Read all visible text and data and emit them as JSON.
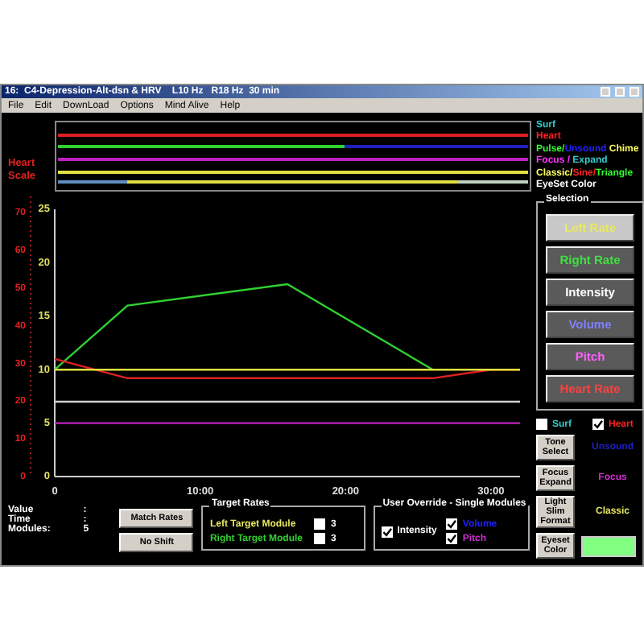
{
  "window": {
    "title": "16:  C4-Depression-Alt-dsn & HRV    L10 Hz   R18 Hz  30 min"
  },
  "menu": [
    "File",
    "Edit",
    "DownLoad",
    "Options",
    "Mind Alive",
    "Help"
  ],
  "legend": [
    {
      "parts": [
        {
          "text": "Surf",
          "color": "#33cccc"
        }
      ]
    },
    {
      "parts": [
        {
          "text": "Heart",
          "color": "#ff2020"
        }
      ]
    },
    {
      "parts": [
        {
          "text": "Pulse/",
          "color": "#30ff30"
        },
        {
          "text": "Unsound",
          "color": "#2020ff"
        },
        {
          "text": " Chime",
          "color": "#ffff60"
        }
      ]
    },
    {
      "parts": [
        {
          "text": "Focus / ",
          "color": "#ff30ff"
        },
        {
          "text": "Expand",
          "color": "#33cccc"
        }
      ]
    },
    {
      "parts": [
        {
          "text": "Classic/",
          "color": "#ffff60"
        },
        {
          "text": "Sine/",
          "color": "#ff2020"
        },
        {
          "text": "Triangle",
          "color": "#30ff30"
        }
      ]
    },
    {
      "parts": [
        {
          "text": "EyeSet Color",
          "color": "#ffffff"
        }
      ]
    }
  ],
  "heart_scale": {
    "label": "Heart Scale",
    "ticks": [
      "70",
      "60",
      "50",
      "40",
      "30",
      "20",
      "10",
      "0"
    ]
  },
  "chart": {
    "chart_data": {
      "type": "line",
      "x": [
        0,
        5,
        16,
        26,
        30,
        32
      ],
      "xlim": [
        0,
        32
      ],
      "ylim": [
        0,
        25
      ],
      "xticks": [
        {
          "value": 0,
          "label": "0"
        },
        {
          "value": 10,
          "label": "10:00"
        },
        {
          "value": 20,
          "label": "20:00"
        },
        {
          "value": 30,
          "label": "30:00"
        }
      ],
      "yticks": [
        0,
        5,
        10,
        15,
        20,
        25
      ],
      "series": [
        {
          "color": "#30d030",
          "values": [
            10,
            16,
            18,
            10,
            null,
            null
          ]
        },
        {
          "color": "#e02020",
          "values": [
            11,
            9.2,
            9.2,
            9.2,
            10,
            10
          ]
        },
        {
          "color": "#e0e040",
          "values": [
            10,
            10,
            10,
            10,
            10,
            10
          ]
        },
        {
          "color": "#d0d0d0",
          "values": [
            7,
            7,
            7,
            7,
            7,
            7
          ]
        },
        {
          "color": "#c020c0",
          "values": [
            5,
            5,
            5,
            5,
            5,
            5
          ]
        }
      ]
    }
  },
  "selection": {
    "title": "Selection",
    "buttons": [
      {
        "label": "Left Rate",
        "color": "#e8e860",
        "selected": true
      },
      {
        "label": "Right Rate",
        "color": "#40e040",
        "selected": false
      },
      {
        "label": "Intensity",
        "color": "#ffffff",
        "selected": false
      },
      {
        "label": "Volume",
        "color": "#8080ff",
        "selected": false
      },
      {
        "label": "Pitch",
        "color": "#ff60ff",
        "selected": false
      },
      {
        "label": "Heart Rate",
        "color": "#ff4040",
        "selected": false
      }
    ]
  },
  "toggles": [
    {
      "label": "Surf",
      "color": "#33cccc",
      "checked": false
    },
    {
      "label": "Heart",
      "color": "#ff2020",
      "checked": true
    }
  ],
  "modes": [
    {
      "button": "Tone Select",
      "value": "Unsound",
      "color": "#2020c0",
      "kind": "text"
    },
    {
      "button": "Focus Expand",
      "value": "Focus",
      "color": "#d030d0",
      "kind": "text"
    },
    {
      "button": "Light Slim Format",
      "value": "Classic",
      "color": "#e8e860",
      "kind": "text"
    },
    {
      "button": "Eyeset Color",
      "color": "#80ff80",
      "kind": "swatch"
    }
  ],
  "info": [
    {
      "label": "Value",
      "value": ":"
    },
    {
      "label": "Time",
      "value": ":"
    },
    {
      "label": "Modules:",
      "value": "5"
    }
  ],
  "actions": [
    "Match Rates",
    "No Shift"
  ],
  "target_rates": {
    "title": "Target Rates",
    "rows": [
      {
        "label": "Left Target Module",
        "color": "#e8e860",
        "checked": false,
        "value": "3"
      },
      {
        "label": "Right Target Module",
        "color": "#30d030",
        "checked": false,
        "value": "3"
      }
    ]
  },
  "override": {
    "title": "User Override - Single Modules",
    "items": [
      {
        "label": "Intensity",
        "color": "#ffffff",
        "checked": true
      },
      {
        "label": "Volume",
        "color": "#2020ff",
        "checked": true
      },
      {
        "label": "Pitch",
        "color": "#d030d0",
        "checked": true
      }
    ]
  }
}
